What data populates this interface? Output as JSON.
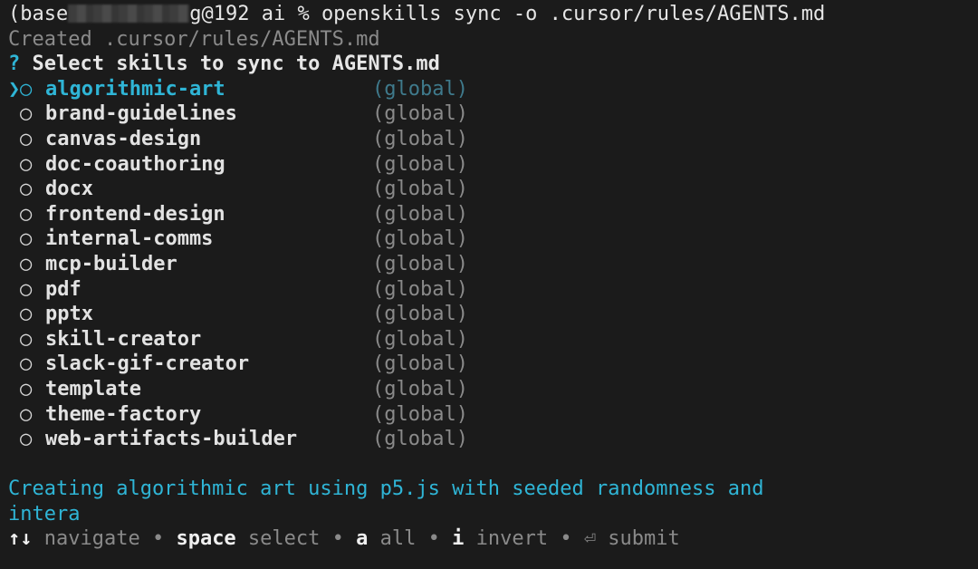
{
  "prompt": {
    "prefix": "(base",
    "host_suffix": "g@192 ai % ",
    "command": "openskills sync -o .cursor/rules/AGENTS.md"
  },
  "output": {
    "created_line": "Created .cursor/rules/AGENTS.md"
  },
  "question": {
    "mark": "?",
    "text": "Select skills to sync to AGENTS.md"
  },
  "pointer_glyph": "❯",
  "radio_glyph": "○",
  "skills": [
    {
      "name": "algorithmic-art",
      "scope": "(global)",
      "active": true
    },
    {
      "name": "brand-guidelines",
      "scope": "(global)",
      "active": false
    },
    {
      "name": "canvas-design",
      "scope": "(global)",
      "active": false
    },
    {
      "name": "doc-coauthoring",
      "scope": "(global)",
      "active": false
    },
    {
      "name": "docx",
      "scope": "(global)",
      "active": false
    },
    {
      "name": "frontend-design",
      "scope": "(global)",
      "active": false
    },
    {
      "name": "internal-comms",
      "scope": "(global)",
      "active": false
    },
    {
      "name": "mcp-builder",
      "scope": "(global)",
      "active": false
    },
    {
      "name": "pdf",
      "scope": "(global)",
      "active": false
    },
    {
      "name": "pptx",
      "scope": "(global)",
      "active": false
    },
    {
      "name": "skill-creator",
      "scope": "(global)",
      "active": false
    },
    {
      "name": "slack-gif-creator",
      "scope": "(global)",
      "active": false
    },
    {
      "name": "template",
      "scope": "(global)",
      "active": false
    },
    {
      "name": "theme-factory",
      "scope": "(global)",
      "active": false
    },
    {
      "name": "web-artifacts-builder",
      "scope": "(global)",
      "active": false
    }
  ],
  "description": {
    "line1": "Creating algorithmic art using p5.js with seeded randomness and",
    "line2": "intera"
  },
  "hints": {
    "arrows": "↑↓",
    "navigate": " navigate • ",
    "space_key": "space",
    "select": " select • ",
    "a_key": "a",
    "all": " all • ",
    "i_key": "i",
    "invert": " invert • ",
    "enter_glyph": "⏎",
    "submit": " submit"
  },
  "colors": {
    "background": "#1b1b1b",
    "accent": "#2fb5d6",
    "dim": "#8a8a8a",
    "text": "#e6e6e6"
  }
}
